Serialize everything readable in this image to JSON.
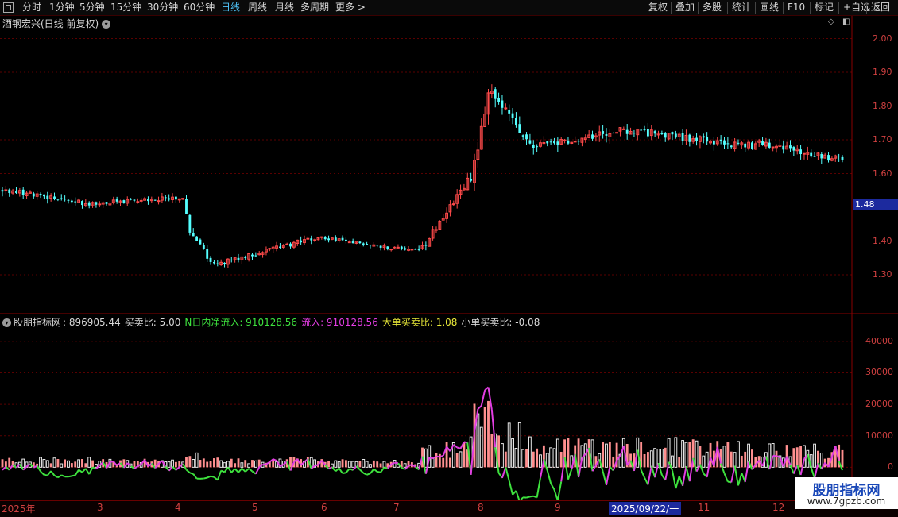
{
  "toolbar": {
    "periods": [
      "分时",
      "1分钟",
      "5分钟",
      "15分钟",
      "30分钟",
      "60分钟",
      "日线",
      "周线",
      "月线",
      "多周期",
      "更多 >"
    ],
    "active_period": "日线",
    "actions": [
      "复权",
      "叠加",
      "多股",
      "统计",
      "画线",
      "F10",
      "+自选",
      "返回"
    ]
  },
  "marks_label": "标记",
  "price_panel": {
    "title": "酒钢宏兴(日线 前复权)",
    "current_price": "1.48",
    "yticks": [
      "2.00",
      "1.90",
      "1.80",
      "1.70",
      "1.60",
      "1.40",
      "1.30"
    ]
  },
  "indicator_panel": {
    "name": "股朋指标网",
    "items": [
      {
        "text": ": 896905.44",
        "color": "#d8d8d8"
      },
      {
        "text": "买卖比: 5.00",
        "color": "#d8d8d8"
      },
      {
        "text": "N日内净流入: 910128.56",
        "color": "#3ee23e"
      },
      {
        "text": "流入: 910128.56",
        "color": "#e63ee6"
      },
      {
        "text": "大单买卖比: 1.08",
        "color": "#e8e838"
      },
      {
        "text": "小单买卖比: -0.08",
        "color": "#d8d8d8"
      }
    ],
    "yticks": [
      "40000",
      "30000",
      "20000",
      "10000",
      "0"
    ]
  },
  "date_axis": {
    "labels": [
      "2025年",
      "3",
      "4",
      "5",
      "6",
      "7",
      "8",
      "9",
      "2025/09/22/一",
      "11",
      "12"
    ],
    "highlight": "2025/09/22/一"
  },
  "watermark": {
    "title": "股朋指标网",
    "url": "www.7gpzb.com"
  },
  "colors": {
    "up": "#ff4a4a",
    "down": "#54ffff",
    "bg": "#000000",
    "axis": "#d04040"
  },
  "chart_data": [
    {
      "type": "candlestick",
      "title": "酒钢宏兴(日线 前复权)",
      "ylim": [
        1.22,
        2.02
      ],
      "x_categories": [
        "2025年",
        "3",
        "4",
        "5",
        "6",
        "7",
        "8",
        "9",
        "10",
        "11",
        "12"
      ],
      "segments": [
        {
          "n": 26,
          "start": 1.55,
          "end": 1.51,
          "vol": 0.12,
          "noise": 0.012
        },
        {
          "n": 26,
          "start": 1.51,
          "end": 1.53,
          "vol": 0.1,
          "noise": 0.01
        },
        {
          "n": 3,
          "start": 1.53,
          "end": 1.43,
          "vol": 0.15,
          "noise": 0.01
        },
        {
          "n": 6,
          "start": 1.42,
          "end": 1.33,
          "vol": 0.18,
          "noise": 0.015
        },
        {
          "n": 30,
          "start": 1.33,
          "end": 1.41,
          "vol": 0.12,
          "noise": 0.01
        },
        {
          "n": 30,
          "start": 1.41,
          "end": 1.37,
          "vol": 0.1,
          "noise": 0.008
        },
        {
          "n": 14,
          "start": 1.38,
          "end": 1.58,
          "vol": 0.3,
          "noise": 0.014
        },
        {
          "n": 6,
          "start": 1.58,
          "end": 1.85,
          "vol": 1.0,
          "noise": 0.03
        },
        {
          "n": 12,
          "start": 1.84,
          "end": 1.68,
          "vol": 0.55,
          "noise": 0.022
        },
        {
          "n": 25,
          "start": 1.68,
          "end": 1.73,
          "vol": 0.35,
          "noise": 0.018
        },
        {
          "n": 40,
          "start": 1.73,
          "end": 1.68,
          "vol": 0.35,
          "noise": 0.016
        },
        {
          "n": 25,
          "start": 1.69,
          "end": 1.64,
          "vol": 0.3,
          "noise": 0.014
        }
      ]
    },
    {
      "type": "bar",
      "name": "股朋指标网",
      "ylim": [
        -10000,
        45000
      ],
      "series_colors": {
        "bars_up": "#ff8f8f",
        "bars_down": "#e8e8e8",
        "flow_pos": "#e23ee2",
        "flow_neg": "#3ee23e"
      }
    }
  ]
}
